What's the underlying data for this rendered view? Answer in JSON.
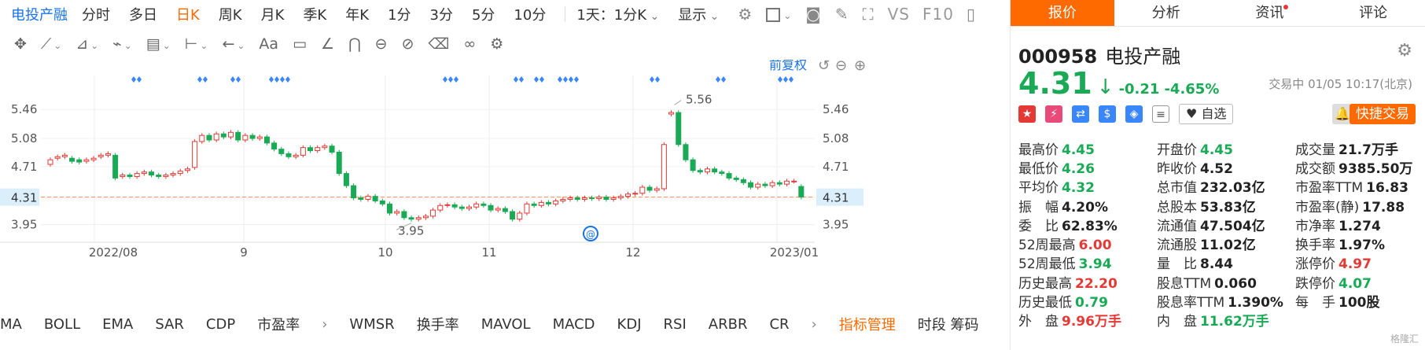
{
  "period_bar": {
    "stock_name": "电投产融",
    "periods": [
      "分时",
      "多日",
      "日K",
      "周K",
      "月K",
      "季K",
      "年K",
      "1分",
      "3分",
      "5分",
      "10分"
    ],
    "active_period": "日K",
    "range_select": "1天：1分K",
    "display_label": "显示",
    "vs_label": "VS",
    "f10_label": "F10"
  },
  "draw_toolbar": {
    "text_tool": "Aa"
  },
  "chart": {
    "adjust_label": "前复权",
    "max_label": "5.56",
    "min_label": "3.95",
    "current_price_label": "4.31",
    "y_ticks": [
      "5.46",
      "5.08",
      "4.71",
      "4.31",
      "3.95"
    ],
    "x_labels": [
      "2022/08",
      "9",
      "10",
      "11",
      "12",
      "2023/01"
    ],
    "colors": {
      "up": "#e53935",
      "down": "#1aaa55",
      "price_line": "#ff8a50",
      "signal": "#3a86ff"
    }
  },
  "chart_data": {
    "type": "candlestick",
    "title": "",
    "x_labels": [
      "2022/08",
      "9",
      "10",
      "11",
      "12",
      "2023/01"
    ],
    "y_ticks": [
      5.46,
      5.08,
      4.71,
      4.31,
      3.95
    ],
    "ylim": [
      3.8,
      5.7
    ],
    "max_point": 5.56,
    "min_point": 3.95,
    "last_price": 4.31,
    "closes": [
      4.8,
      4.84,
      4.86,
      4.78,
      4.77,
      4.8,
      4.82,
      4.86,
      4.88,
      4.56,
      4.6,
      4.58,
      4.62,
      4.64,
      4.6,
      4.58,
      4.6,
      4.62,
      4.65,
      4.68,
      5.04,
      5.12,
      5.06,
      5.14,
      5.1,
      5.16,
      5.06,
      5.12,
      5.08,
      5.1,
      5.02,
      4.94,
      4.88,
      4.84,
      4.86,
      4.96,
      4.92,
      4.96,
      4.98,
      4.9,
      4.62,
      4.46,
      4.3,
      4.28,
      4.32,
      4.26,
      4.22,
      4.1,
      4.12,
      4.04,
      4.02,
      4.04,
      4.06,
      4.14,
      4.2,
      4.21,
      4.18,
      4.16,
      4.18,
      4.22,
      4.2,
      4.14,
      4.16,
      4.12,
      4.02,
      4.1,
      4.22,
      4.2,
      4.24,
      4.22,
      4.26,
      4.28,
      4.3,
      4.28,
      4.3,
      4.29,
      4.31,
      4.28,
      4.3,
      4.32,
      4.35,
      4.36,
      4.44,
      4.4,
      4.42,
      5.0,
      5.42,
      5.0,
      4.8,
      4.66,
      4.64,
      4.68,
      4.64,
      4.62,
      4.56,
      4.54,
      4.5,
      4.44,
      4.48,
      4.46,
      4.5,
      4.48,
      4.52,
      4.52,
      4.31
    ],
    "opens": [
      4.74,
      4.82,
      4.84,
      4.82,
      4.8,
      4.78,
      4.8,
      4.84,
      4.86,
      4.86,
      4.58,
      4.6,
      4.58,
      4.62,
      4.64,
      4.6,
      4.58,
      4.6,
      4.62,
      4.66,
      4.7,
      5.04,
      5.12,
      5.06,
      5.14,
      5.1,
      5.16,
      5.06,
      5.12,
      5.08,
      5.1,
      5.02,
      4.94,
      4.88,
      4.84,
      4.86,
      4.96,
      4.92,
      4.96,
      4.98,
      4.9,
      4.62,
      4.46,
      4.3,
      4.28,
      4.32,
      4.26,
      4.22,
      4.1,
      4.12,
      4.04,
      4.02,
      4.04,
      4.06,
      4.14,
      4.2,
      4.21,
      4.18,
      4.16,
      4.18,
      4.22,
      4.2,
      4.14,
      4.16,
      4.12,
      4.02,
      4.1,
      4.22,
      4.2,
      4.24,
      4.22,
      4.26,
      4.28,
      4.3,
      4.28,
      4.3,
      4.29,
      4.31,
      4.28,
      4.3,
      4.32,
      4.35,
      4.36,
      4.44,
      4.4,
      4.42,
      5.4,
      5.42,
      5.0,
      4.8,
      4.66,
      4.64,
      4.68,
      4.64,
      4.62,
      4.56,
      4.54,
      4.5,
      4.44,
      4.48,
      4.46,
      4.5,
      4.48,
      4.52,
      4.45
    ]
  },
  "indicator_bar": {
    "items": [
      "MA",
      "BOLL",
      "EMA",
      "SAR",
      "CDP",
      "市盈率",
      "WMSR",
      "换手率",
      "MAVOL",
      "MACD",
      "KDJ",
      "RSI",
      "ARBR",
      "CR"
    ],
    "manager": "指标管理",
    "extra": "时段 筹码"
  },
  "panel": {
    "tabs": [
      "报价",
      "分析",
      "资讯",
      "评论"
    ],
    "code": "000958",
    "name": "电投产融",
    "price": "4.31",
    "change": "-0.21",
    "change_pct": "-4.65%",
    "status": "交易中 01/05 10:17(北京)",
    "watch_label": "自选",
    "trade_label": "快捷交易",
    "stats": [
      [
        {
          "l": "最高价",
          "v": "4.45",
          "c": "g"
        },
        {
          "l": "开盘价",
          "v": "4.45",
          "c": "g"
        },
        {
          "l": "成交量",
          "v": "21.7万手",
          "c": "k"
        }
      ],
      [
        {
          "l": "最低价",
          "v": "4.26",
          "c": "g"
        },
        {
          "l": "昨收价",
          "v": "4.52",
          "c": "k"
        },
        {
          "l": "成交额",
          "v": "9385.50万",
          "c": "k"
        }
      ],
      [
        {
          "l": "平均价",
          "v": "4.32",
          "c": "g"
        },
        {
          "l": "总市值",
          "v": "232.03亿",
          "c": "k"
        },
        {
          "l": "市盈率TTM",
          "v": "16.83",
          "c": "k"
        }
      ],
      [
        {
          "l": "振　幅",
          "v": "4.20%",
          "c": "k"
        },
        {
          "l": "总股本",
          "v": "53.83亿",
          "c": "k"
        },
        {
          "l": "市盈率(静)",
          "v": "17.88",
          "c": "k"
        }
      ],
      [
        {
          "l": "委　比",
          "v": "62.83%",
          "c": "k"
        },
        {
          "l": "流通值",
          "v": "47.504亿",
          "c": "k"
        },
        {
          "l": "市净率",
          "v": "1.274",
          "c": "k"
        }
      ],
      [
        {
          "l": "52周最高",
          "v": "6.00",
          "c": "r"
        },
        {
          "l": "流通股",
          "v": "11.02亿",
          "c": "k"
        },
        {
          "l": "换手率",
          "v": "1.97%",
          "c": "k"
        }
      ],
      [
        {
          "l": "52周最低",
          "v": "3.94",
          "c": "g"
        },
        {
          "l": "量　比",
          "v": "8.44",
          "c": "k"
        },
        {
          "l": "涨停价",
          "v": "4.97",
          "c": "r"
        }
      ],
      [
        {
          "l": "历史最高",
          "v": "22.20",
          "c": "r"
        },
        {
          "l": "股息TTM",
          "v": "0.060",
          "c": "k"
        },
        {
          "l": "跌停价",
          "v": "4.07",
          "c": "g"
        }
      ],
      [
        {
          "l": "历史最低",
          "v": "0.79",
          "c": "g"
        },
        {
          "l": "股息率TTM",
          "v": "1.390%",
          "c": "k"
        },
        {
          "l": "每　手",
          "v": "100股",
          "c": "k"
        }
      ],
      [
        {
          "l": "外　盘",
          "v": "9.96万手",
          "c": "r"
        },
        {
          "l": "内　盘",
          "v": "11.62万手",
          "c": "g"
        },
        {
          "l": "",
          "v": "",
          "c": "k"
        }
      ]
    ],
    "watermark": "格隆汇"
  }
}
